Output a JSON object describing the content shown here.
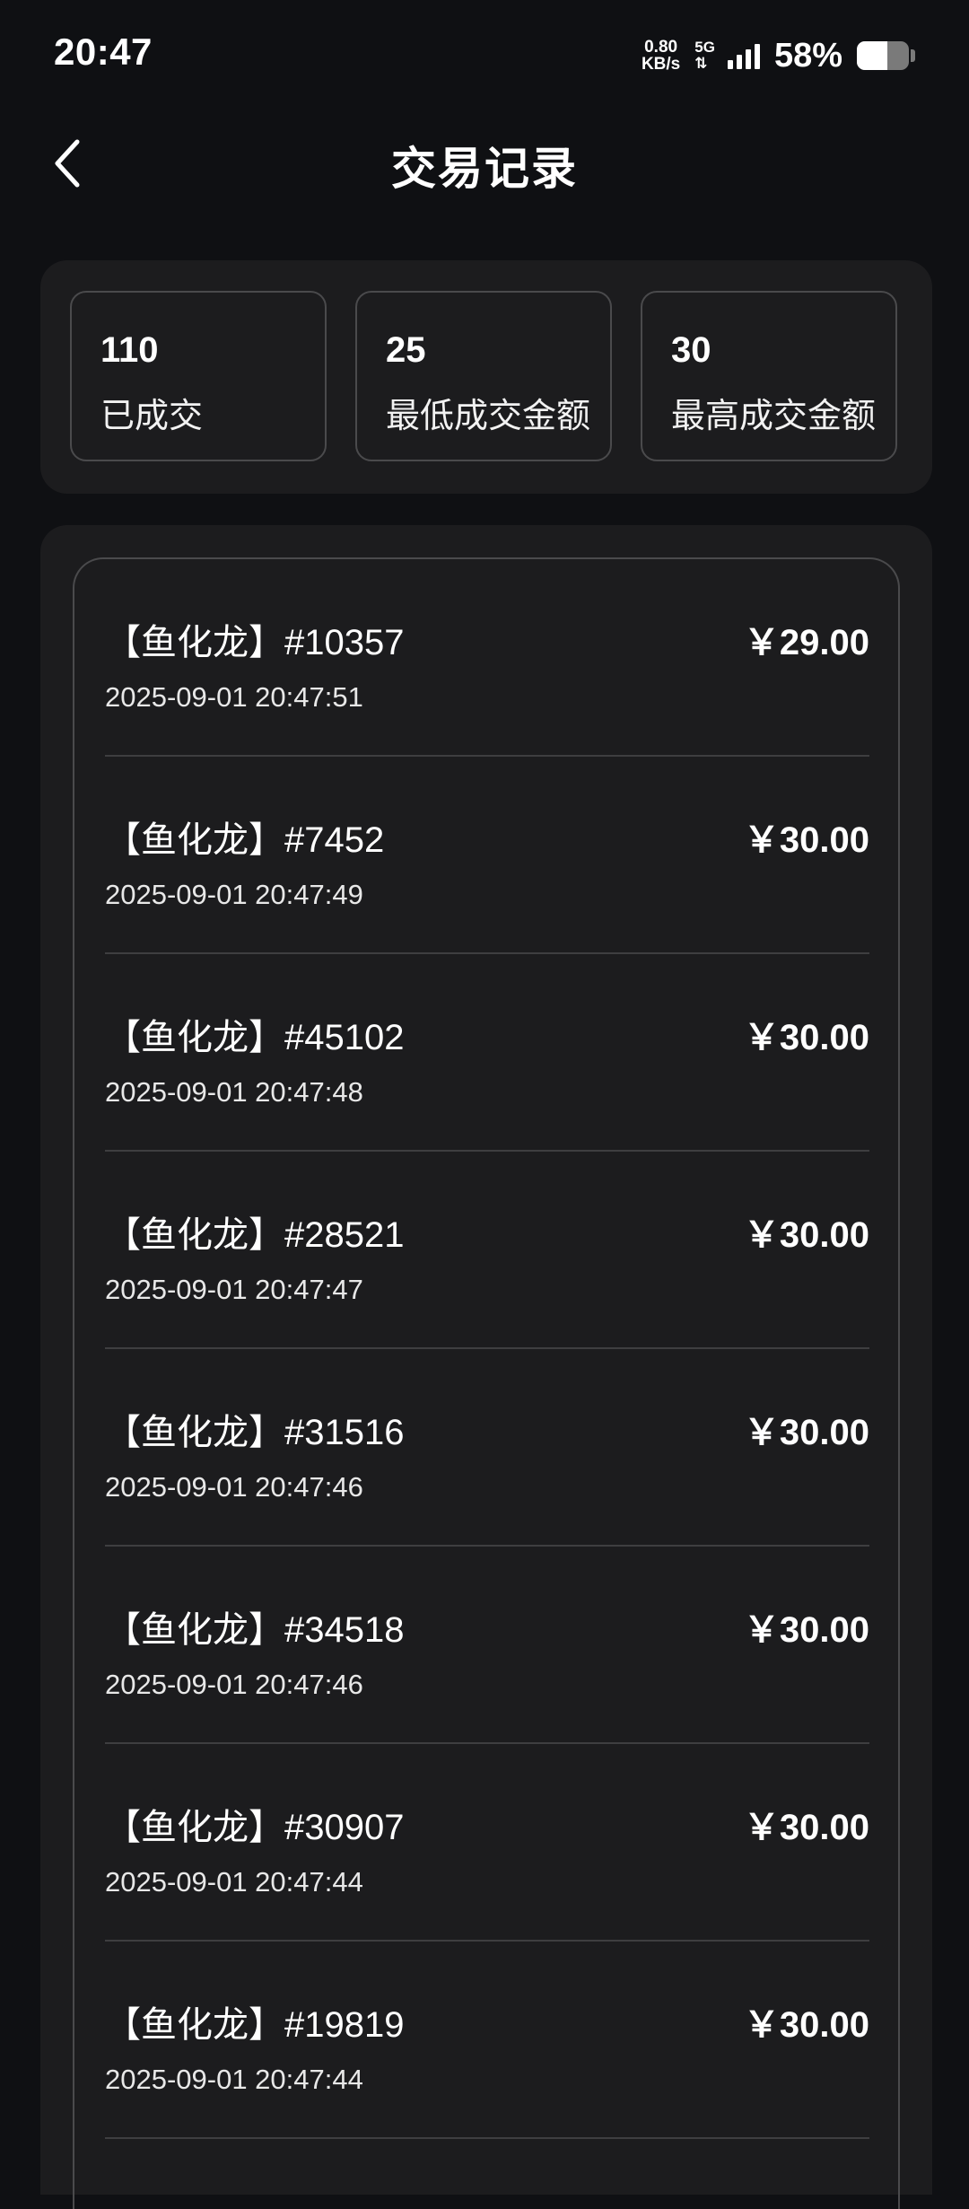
{
  "status_bar": {
    "time": "20:47",
    "net_speed_value": "0.80",
    "net_speed_unit": "KB/s",
    "network_type": "5G",
    "network_arrows": "⇅",
    "battery_percent": "58%",
    "battery_level": 0.58
  },
  "header": {
    "title": "交易记录",
    "back_icon": "chevron-left-icon"
  },
  "stats": [
    {
      "value": "110",
      "label": "已成交"
    },
    {
      "value": "25",
      "label": "最低成交金额"
    },
    {
      "value": "30",
      "label": "最高成交金额"
    }
  ],
  "records": [
    {
      "title": "【鱼化龙】#10357",
      "price": "￥29.00",
      "time": "2025-09-01 20:47:51"
    },
    {
      "title": "【鱼化龙】#7452",
      "price": "￥30.00",
      "time": "2025-09-01 20:47:49"
    },
    {
      "title": "【鱼化龙】#45102",
      "price": "￥30.00",
      "time": "2025-09-01 20:47:48"
    },
    {
      "title": "【鱼化龙】#28521",
      "price": "￥30.00",
      "time": "2025-09-01 20:47:47"
    },
    {
      "title": "【鱼化龙】#31516",
      "price": "￥30.00",
      "time": "2025-09-01 20:47:46"
    },
    {
      "title": "【鱼化龙】#34518",
      "price": "￥30.00",
      "time": "2025-09-01 20:47:46"
    },
    {
      "title": "【鱼化龙】#30907",
      "price": "￥30.00",
      "time": "2025-09-01 20:47:44"
    },
    {
      "title": "【鱼化龙】#19819",
      "price": "￥30.00",
      "time": "2025-09-01 20:47:44"
    }
  ]
}
